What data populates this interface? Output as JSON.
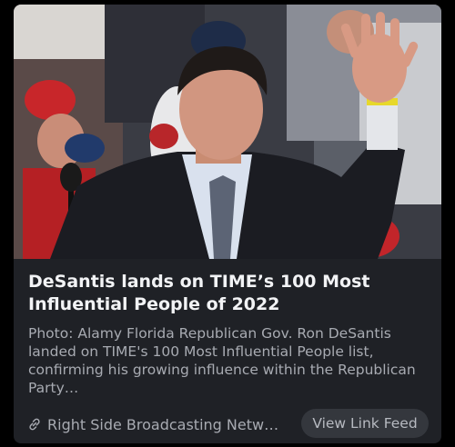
{
  "card": {
    "image_alt": "Ron DeSantis waving at a rally",
    "title": "DeSantis lands on TIME’s 100 Most Influential People of 2022",
    "description": "Photo: Alamy Florida Republican Gov. Ron DeSantis landed on TIME's 100 Most Influential People list, confirming his growing influence within the Republican Party…",
    "source": "Right Side Broadcasting Netw…",
    "source_icon": "link-icon",
    "button_label": "View Link Feed"
  },
  "colors": {
    "card_background": "#1f2126",
    "title_text": "#f2f3f5",
    "secondary_text": "#a8abb2",
    "button_background": "#34373d"
  }
}
